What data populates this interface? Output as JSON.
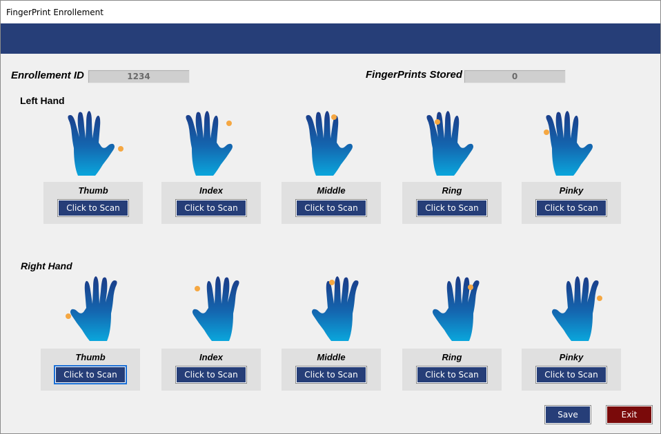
{
  "window": {
    "title": "FingerPrint Enrollement"
  },
  "enrollment": {
    "label": "Enrollement ID",
    "value": "1234"
  },
  "stored": {
    "label": "FingerPrints Stored",
    "value": "0"
  },
  "left_hand": {
    "title": "Left Hand",
    "fingers": [
      {
        "name": "Thumb",
        "button": "Click to Scan"
      },
      {
        "name": "Index",
        "button": "Click to Scan"
      },
      {
        "name": "Middle",
        "button": "Click to Scan"
      },
      {
        "name": "Ring",
        "button": "Click to Scan"
      },
      {
        "name": "Pinky",
        "button": "Click to Scan"
      }
    ]
  },
  "right_hand": {
    "title": "Right Hand",
    "fingers": [
      {
        "name": "Thumb",
        "button": "Click to Scan"
      },
      {
        "name": "Index",
        "button": "Click to Scan"
      },
      {
        "name": "Middle",
        "button": "Click to Scan"
      },
      {
        "name": "Ring",
        "button": "Click to Scan"
      },
      {
        "name": "Pinky",
        "button": "Click to Scan"
      }
    ]
  },
  "actions": {
    "save": "Save",
    "exit": "Exit"
  },
  "colors": {
    "banner": "#263e78",
    "button": "#263e78",
    "exit": "#7a0a0a",
    "hand_top": "#1a3f8a",
    "hand_bottom": "#0aa0d8",
    "fingertip": "#f5a742"
  }
}
